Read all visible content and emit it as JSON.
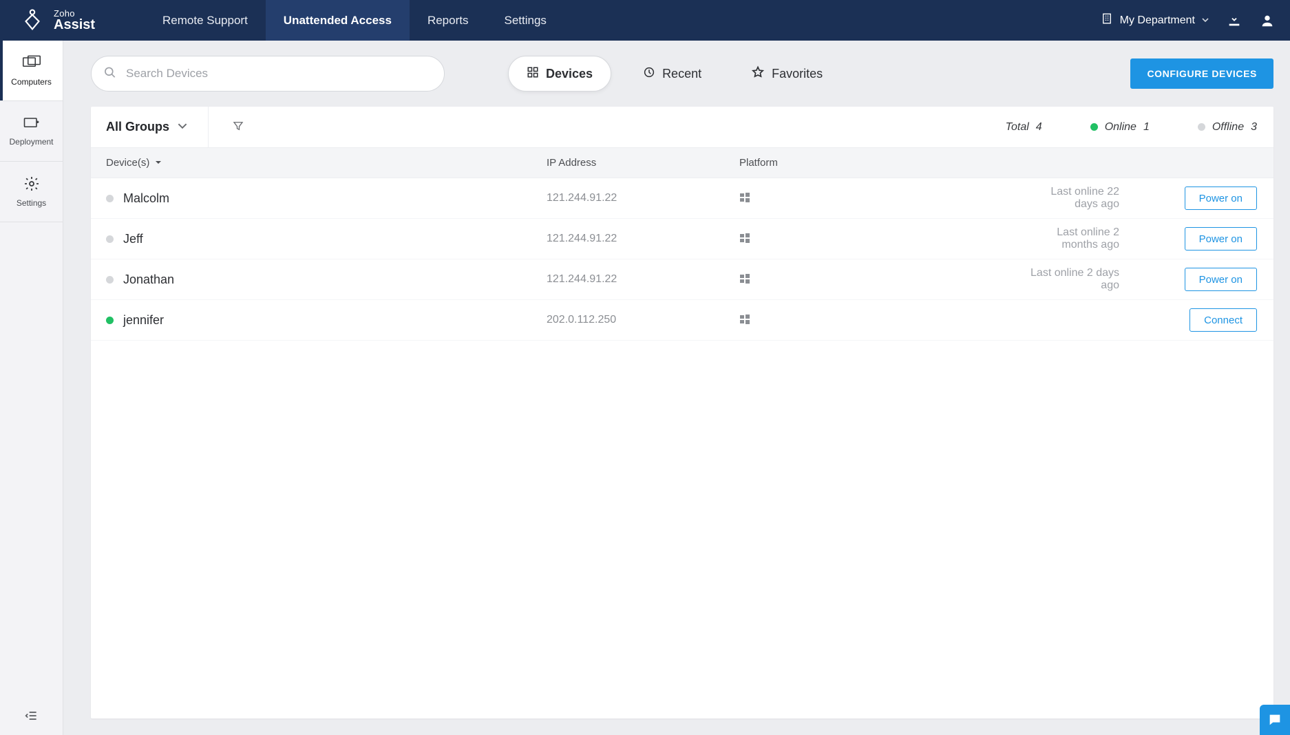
{
  "header": {
    "product_top": "Zoho",
    "product_name": "Assist",
    "tabs": [
      {
        "label": "Remote Support",
        "active": false
      },
      {
        "label": "Unattended Access",
        "active": true
      },
      {
        "label": "Reports",
        "active": false
      },
      {
        "label": "Settings",
        "active": false
      }
    ],
    "department_label": "My Department"
  },
  "sidebar": {
    "items": [
      {
        "label": "Computers",
        "icon": "monitors-icon",
        "active": true
      },
      {
        "label": "Deployment",
        "icon": "deploy-icon",
        "active": false
      },
      {
        "label": "Settings",
        "icon": "gear-icon",
        "active": false
      }
    ]
  },
  "toolbar": {
    "search_placeholder": "Search Devices",
    "pills": [
      {
        "label": "Devices",
        "icon": "grid-icon",
        "active": true
      },
      {
        "label": "Recent",
        "icon": "clock-icon",
        "active": false
      },
      {
        "label": "Favorites",
        "icon": "star-icon",
        "active": false
      }
    ],
    "configure_label": "CONFIGURE DEVICES"
  },
  "panel": {
    "groups_label": "All Groups",
    "stats": {
      "total_label": "Total",
      "total_value": "4",
      "online_label": "Online",
      "online_value": "1",
      "offline_label": "Offline",
      "offline_value": "3"
    },
    "columns": {
      "devices": "Device(s)",
      "ip": "IP Address",
      "platform": "Platform"
    }
  },
  "devices": [
    {
      "name": "Malcolm",
      "ip": "121.244.91.22",
      "online": false,
      "last_seen": "Last online 22 days ago",
      "action": "Power on"
    },
    {
      "name": "Jeff",
      "ip": "121.244.91.22",
      "online": false,
      "last_seen": "Last online 2 months ago",
      "action": "Power on"
    },
    {
      "name": "Jonathan",
      "ip": "121.244.91.22",
      "online": false,
      "last_seen": "Last online 2 days ago",
      "action": "Power on"
    },
    {
      "name": "jennifer",
      "ip": "202.0.112.250",
      "online": true,
      "last_seen": "",
      "action": "Connect"
    }
  ],
  "colors": {
    "accent": "#1e94e3",
    "nav": "#1b3055",
    "online": "#21c064",
    "offline": "#d5d7da"
  }
}
